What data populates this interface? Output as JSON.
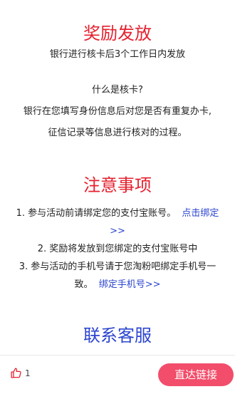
{
  "reward": {
    "title": "奖励发放",
    "subtitle": "银行进行核卡后3个工作日内发放"
  },
  "verify": {
    "question": "什么是核卡?",
    "line1": "银行在您填写身份信息后对您是否有重复办卡,",
    "line2": "征信记录等信息进行核对的过程。"
  },
  "notes": {
    "title": "注意事项",
    "item1_text": "1. 参与活动前请绑定您的支付宝账号。",
    "item1_link": "点击绑定",
    "item1_link_cont": ">>",
    "item2_text": "2. 奖励将发放到您绑定的支付宝账号中",
    "item3_text": "3. 参与活动的手机号请于您淘粉吧绑定手机号一",
    "item3_cont": "致。",
    "item3_link": "绑定手机号>>"
  },
  "contact": {
    "title": "联系客服"
  },
  "bottom_bar": {
    "like_icon": "thumbs-up-icon",
    "like_count": "1",
    "cta_label": "直达链接"
  },
  "colors": {
    "heading_red": "#e5202e",
    "heading_blue": "#2b45cf",
    "link_blue": "#2b45cf",
    "cta_bg": "#f24d6a"
  }
}
